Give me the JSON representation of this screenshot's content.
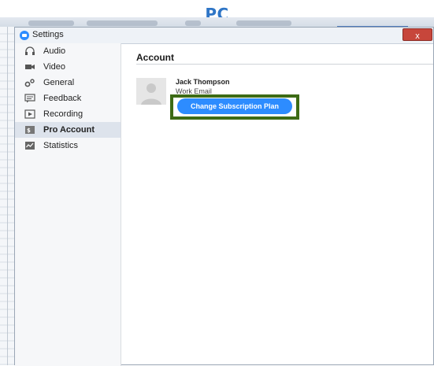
{
  "caption": "PC",
  "window": {
    "title": "Settings",
    "close_label": "x"
  },
  "sidebar": {
    "items": [
      {
        "label": "Audio",
        "icon": "headphones-icon",
        "active": false
      },
      {
        "label": "Video",
        "icon": "video-camera-icon",
        "active": false
      },
      {
        "label": "General",
        "icon": "gears-icon",
        "active": false
      },
      {
        "label": "Feedback",
        "icon": "chat-icon",
        "active": false
      },
      {
        "label": "Recording",
        "icon": "play-icon",
        "active": false
      },
      {
        "label": "Pro Account",
        "icon": "account-icon",
        "active": true
      },
      {
        "label": "Statistics",
        "icon": "statistics-icon",
        "active": false
      }
    ]
  },
  "content": {
    "title": "Account",
    "user_name": "Jack Thompson",
    "user_email": "Work Email",
    "plan_button_label": "Change Subscription Plan"
  },
  "colors": {
    "accent": "#2d8cff",
    "highlight_border": "#3d6b16",
    "caption": "#2e75c6",
    "close_button": "#c7463b"
  }
}
